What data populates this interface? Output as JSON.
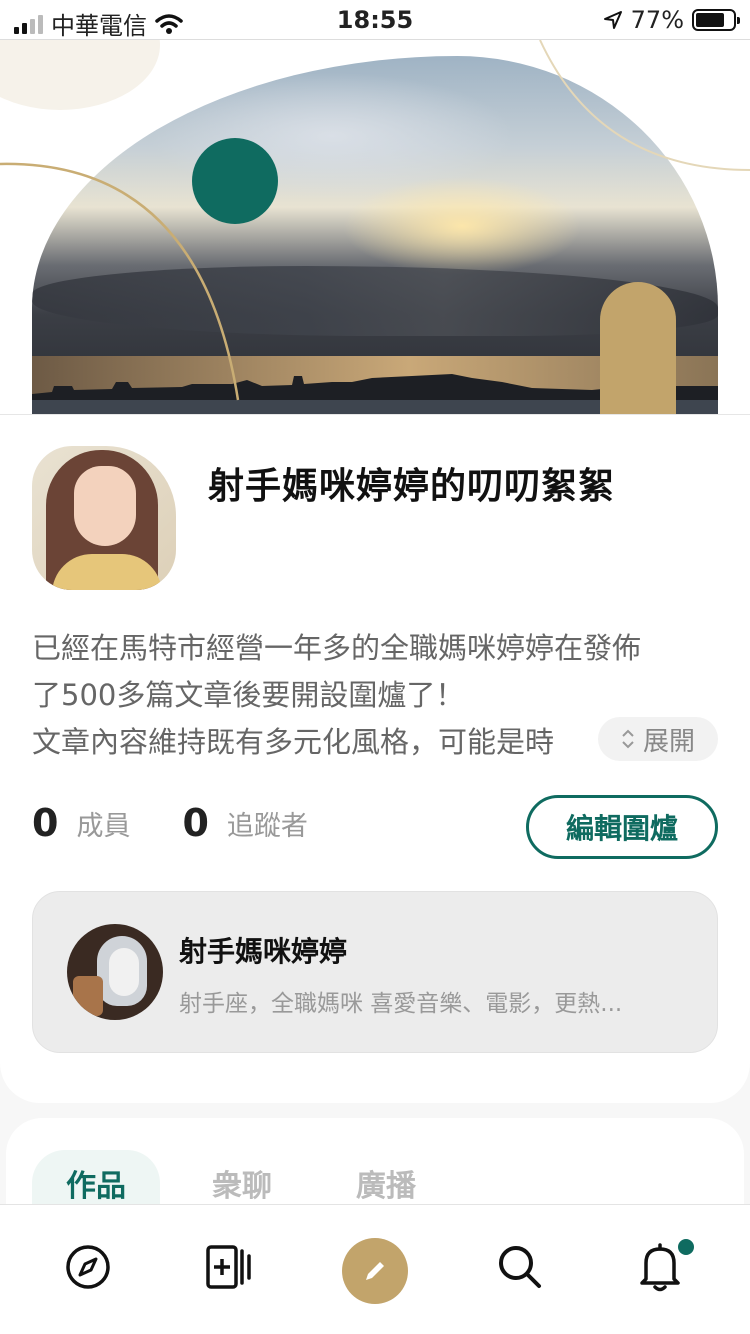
{
  "status_bar": {
    "carrier": "中華電信",
    "time": "18:55",
    "battery": "77%",
    "battery_level": 0.77,
    "icons": [
      "signal-icon",
      "wifi-icon",
      "location-arrow-icon",
      "battery-icon"
    ]
  },
  "room": {
    "title": "射手媽咪婷婷的叨叨絮絮",
    "description_lines": [
      "已經在馬特市經營一年多的全職媽咪婷婷在發佈",
      "了500多篇文章後要開設圍爐了！",
      "文章內容維持既有多元化風格，可能是時"
    ],
    "expand_label": "展開"
  },
  "stats": {
    "members_count": "0",
    "members_label": "成員",
    "followers_count": "0",
    "followers_label": "追蹤者"
  },
  "edit_button_label": "編輯圍爐",
  "owner": {
    "name": "射手媽咪婷婷",
    "bio": "射手座，全職媽咪 喜愛音樂、電影，更熱..."
  },
  "tabs": [
    {
      "label": "作品",
      "active": true
    },
    {
      "label": "衆聊",
      "active": false
    },
    {
      "label": "廣播",
      "active": false
    }
  ],
  "bottom_nav": {
    "items": [
      "compass-icon",
      "add-page-icon",
      "pencil-icon",
      "search-icon",
      "bell-icon"
    ],
    "has_notification": true
  },
  "colors": {
    "accent_teal": "#0f6b60",
    "accent_gold": "#c2a46b"
  }
}
